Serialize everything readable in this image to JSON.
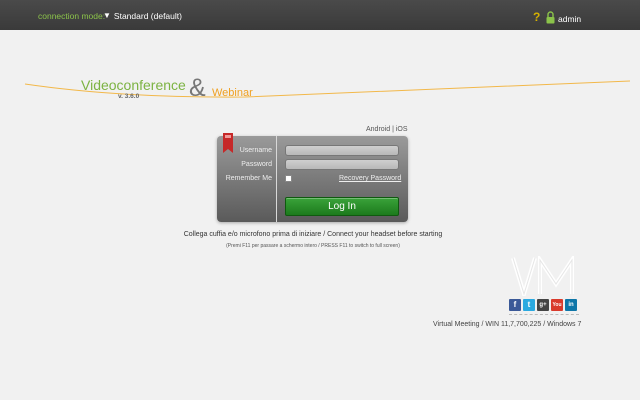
{
  "topbar": {
    "connection_label": "connection mode:",
    "connection_value": "Standard (default)",
    "help_icon": "question-icon",
    "lock_icon": "lock-icon",
    "user_label": "admin"
  },
  "brand": {
    "title_left": "Videoconference",
    "version": "v. 3.6.0",
    "ampersand": "&",
    "title_right": "Webinar"
  },
  "platform_links": {
    "android": "Android",
    "separator": "|",
    "ios": "iOS"
  },
  "login": {
    "username_label": "Username",
    "password_label": "Password",
    "remember_label": "Remember Me",
    "username_value": "",
    "password_value": "",
    "remember_checked": false,
    "recovery_label": "Recovery Password",
    "button_label": "Log In"
  },
  "messages": {
    "headset": "Collega cuffia e/o microfono prima di iniziare / Connect your headset before starting",
    "fullscreen": "(Premi F11 per passare a schermo intero / PRESS F11 to switch to full screen)"
  },
  "social": [
    {
      "name": "facebook",
      "glyph": "f"
    },
    {
      "name": "twitter",
      "glyph": "t"
    },
    {
      "name": "google-plus",
      "glyph": "g+"
    },
    {
      "name": "youtube",
      "glyph": "You"
    },
    {
      "name": "linkedin",
      "glyph": "in"
    }
  ],
  "footer": {
    "info": "Virtual Meeting / WIN 11,7,700,225 / Windows 7"
  },
  "colors": {
    "topbar": "#404040",
    "accent_green": "#7cb342",
    "accent_orange": "#f0a020",
    "button_green": "#2a8f2a"
  }
}
